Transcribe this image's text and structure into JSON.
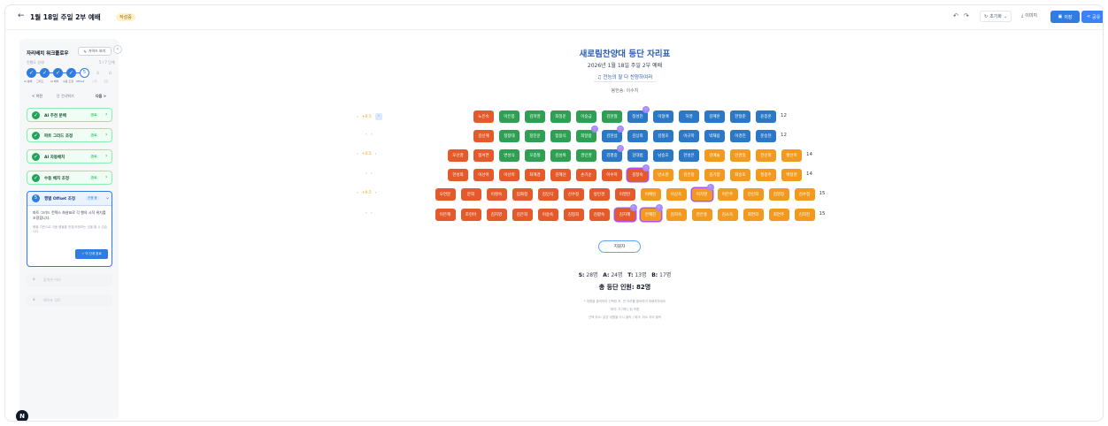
{
  "header": {
    "back_glyph": "←",
    "title": "1월 18일 주일 2부 예배",
    "badge": "작성중",
    "undo_icon": "undo-icon",
    "redo_icon": "redo-icon",
    "reset_label": "초기화",
    "download_label": "이미지",
    "save_label": "저장",
    "share_label": "공유"
  },
  "sidebar": {
    "title": "자리배치 워크플로우",
    "guide_label": "가이드 보기",
    "progress_label": "진행도 상태",
    "progress_value": "5 / 7 단계",
    "steps": [
      {
        "glyph": "✓",
        "label": "AI 분배"
      },
      {
        "glyph": "✓",
        "label": "그리드"
      },
      {
        "glyph": "✓",
        "label": "AI 배치"
      },
      {
        "glyph": "✓",
        "label": "수동 조정"
      },
      {
        "glyph": "5",
        "label": "Offset"
      },
      {
        "glyph": "⌂",
        "label": "출력"
      },
      {
        "glyph": "⌂",
        "label": "검토"
      }
    ],
    "nav_prev": "< 이전",
    "nav_mid": "단 건너뛰기",
    "nav_next": "다음 >",
    "done_steps": [
      {
        "label": "AI 추천 분배",
        "status": "완료"
      },
      {
        "label": "파트 그리드 조정",
        "status": "완료"
      },
      {
        "label": "AI 자동배치",
        "status": "완료"
      },
      {
        "label": "수동 배치 조정",
        "status": "완료"
      }
    ],
    "active_step": {
      "num": "5",
      "label": "행별 Offset 조정",
      "status": "진행 중",
      "desc": "파트 그리드 컨텍스 화살표로 각 행의 시작 위치를 조정합니다.",
      "note": "행을 기준으로 이동 행들을 반영/조정하는 것을 할 수 있습니다.",
      "button": "✓ 이 단계 완료"
    },
    "locked_steps": [
      {
        "icon": "lock-icon",
        "label": "출력본 미리"
      },
      {
        "icon": "lock-icon",
        "label": "배치표 검토"
      }
    ]
  },
  "main": {
    "title": "새로림찬양대 등단 자리표",
    "subtitle": "2026년 1월 18일 주일 2부 예배",
    "hymn": "♫ 전능의 팔 다 찬양하여라",
    "accompanist": "봉헌송: 이수지",
    "conductor": "지휘자",
    "summary": {
      "S_label": "S:",
      "S_value": "28명",
      "A_label": "A:",
      "A_value": "24명",
      "T_label": "T:",
      "T_value": "13명",
      "B_label": "B:",
      "B_value": "17명"
    },
    "total": "총 등단 인원: 82명",
    "hints": [
      "* 대원을 클릭하여 선택한 후, 빈 자리를 클릭하여 재배치하세요",
      "위치: 초기화 | 팀 포함",
      "선택 취소: 같은 대원을 다시 클릭 | 제거: 취소 자리 클릭"
    ]
  },
  "rows": [
    {
      "label_prefix": "‹ ",
      "offset": "+0.5",
      "label_suffix": " ›",
      "count": "12",
      "seats": [
        {
          "n": "노은숙",
          "p": "T"
        },
        {
          "n": "이은봉",
          "p": "S"
        },
        {
          "n": "김학영",
          "p": "S"
        },
        {
          "n": "최정운",
          "p": "S"
        },
        {
          "n": "이승금",
          "p": "S"
        },
        {
          "n": "김현철",
          "p": "S"
        },
        {
          "n": "정성진",
          "p": "A",
          "h": true
        },
        {
          "n": "이형애",
          "p": "A"
        },
        {
          "n": "허영",
          "p": "A"
        },
        {
          "n": "김혜훈",
          "p": "A"
        },
        {
          "n": "한형준",
          "p": "A"
        },
        {
          "n": "윤종훈",
          "p": "A"
        }
      ]
    },
    {
      "label_prefix": "‹",
      "offset": "",
      "label_suffix": " ›",
      "count": "12",
      "seats": [
        {
          "n": "김신혜",
          "p": "T"
        },
        {
          "n": "정창대",
          "p": "S"
        },
        {
          "n": "정진운",
          "p": "S"
        },
        {
          "n": "함용식",
          "p": "S"
        },
        {
          "n": "최달람",
          "p": "S",
          "h": true
        },
        {
          "n": "김현섭",
          "p": "A",
          "h": true
        },
        {
          "n": "김상희",
          "p": "A"
        },
        {
          "n": "김철호",
          "p": "A"
        },
        {
          "n": "이규학",
          "p": "A"
        },
        {
          "n": "박재용",
          "p": "A"
        },
        {
          "n": "이경진",
          "p": "A"
        },
        {
          "n": "문승현",
          "p": "A"
        }
      ]
    },
    {
      "label_prefix": "‹ ",
      "offset": "+0.5",
      "label_suffix": " ›",
      "count": "14",
      "seats": [
        {
          "n": "오선영",
          "p": "T"
        },
        {
          "n": "정서연",
          "p": "T"
        },
        {
          "n": "변성식",
          "p": "S"
        },
        {
          "n": "오종철",
          "p": "S"
        },
        {
          "n": "김성복",
          "p": "S"
        },
        {
          "n": "권민영",
          "p": "S"
        },
        {
          "n": "김평중",
          "p": "A",
          "h": true
        },
        {
          "n": "강대범",
          "p": "A"
        },
        {
          "n": "남승호",
          "p": "A"
        },
        {
          "n": "한성은",
          "p": "A"
        },
        {
          "n": "김예슬",
          "p": "B"
        },
        {
          "n": "안경일",
          "p": "B"
        },
        {
          "n": "전선희",
          "p": "B"
        },
        {
          "n": "황선미",
          "p": "B"
        }
      ]
    },
    {
      "label_prefix": "‹",
      "offset": "",
      "label_suffix": " ›",
      "count": "14",
      "seats": [
        {
          "n": "한성희",
          "p": "T"
        },
        {
          "n": "이선아",
          "p": "T"
        },
        {
          "n": "이선미",
          "p": "T"
        },
        {
          "n": "최혜경",
          "p": "T"
        },
        {
          "n": "김혜선",
          "p": "T"
        },
        {
          "n": "손기순",
          "p": "T"
        },
        {
          "n": "이수지",
          "p": "T"
        },
        {
          "n": "김창숙",
          "p": "T",
          "sel": true,
          "h": true
        },
        {
          "n": "반소현",
          "p": "B"
        },
        {
          "n": "김은정",
          "p": "B"
        },
        {
          "n": "김기정",
          "p": "B"
        },
        {
          "n": "최승호",
          "p": "B"
        },
        {
          "n": "정종주",
          "p": "B"
        },
        {
          "n": "백정현",
          "p": "B"
        }
      ]
    },
    {
      "label_prefix": "‹ ",
      "offset": "+0.5",
      "label_suffix": " ›",
      "count": "15",
      "seats": [
        {
          "n": "오연분",
          "p": "T"
        },
        {
          "n": "문희",
          "p": "T"
        },
        {
          "n": "이명숙",
          "p": "T"
        },
        {
          "n": "임화정",
          "p": "T"
        },
        {
          "n": "김민식",
          "p": "T"
        },
        {
          "n": "신수정",
          "p": "T"
        },
        {
          "n": "방인경",
          "p": "T"
        },
        {
          "n": "이영란",
          "p": "T"
        },
        {
          "n": "이애린",
          "p": "B"
        },
        {
          "n": "이상옥",
          "p": "B"
        },
        {
          "n": "이지영",
          "p": "B",
          "sel": true,
          "h": true
        },
        {
          "n": "이은주",
          "p": "B"
        },
        {
          "n": "전인희",
          "p": "B"
        },
        {
          "n": "김영정",
          "p": "B"
        },
        {
          "n": "김수정",
          "p": "B"
        }
      ]
    },
    {
      "label_prefix": "‹",
      "offset": "",
      "label_suffix": " ›",
      "count": "15",
      "seats": [
        {
          "n": "이은혜",
          "p": "T"
        },
        {
          "n": "조현아",
          "p": "T"
        },
        {
          "n": "김지영",
          "p": "T"
        },
        {
          "n": "김은희",
          "p": "T"
        },
        {
          "n": "이승숙",
          "p": "T"
        },
        {
          "n": "김정희",
          "p": "T"
        },
        {
          "n": "김향숙",
          "p": "T"
        },
        {
          "n": "김지혜",
          "p": "T",
          "sel": true,
          "h": true
        },
        {
          "n": "안혜진",
          "p": "B",
          "sel": true,
          "h": true
        },
        {
          "n": "김하숙",
          "p": "B"
        },
        {
          "n": "한은홍",
          "p": "B"
        },
        {
          "n": "김소옥",
          "p": "B"
        },
        {
          "n": "최연희",
          "p": "B"
        },
        {
          "n": "최연주",
          "p": "B"
        },
        {
          "n": "김희진",
          "p": "B"
        }
      ]
    }
  ]
}
